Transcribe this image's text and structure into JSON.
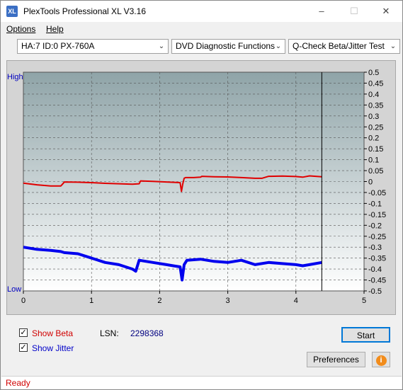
{
  "window": {
    "title": "PlexTools Professional XL V3.16",
    "icon_text": "XL"
  },
  "menu": {
    "items": [
      {
        "label": "Options"
      },
      {
        "label": "Help"
      }
    ]
  },
  "toolbar": {
    "drive": "HA:7 ID:0  PX-760A",
    "function": "DVD Diagnostic Functions",
    "test": "Q-Check Beta/Jitter Test"
  },
  "chart_data": {
    "type": "line",
    "ylabel_top": "High",
    "ylabel_bottom": "Low",
    "x_ticks": [
      "0",
      "1",
      "2",
      "3",
      "4",
      "5"
    ],
    "xlim": [
      0,
      5
    ],
    "y_ticks": [
      "0.5",
      "0.45",
      "0.4",
      "0.35",
      "0.3",
      "0.25",
      "0.2",
      "0.15",
      "0.1",
      "0.05",
      "0",
      "-0.05",
      "-0.1",
      "-0.15",
      "-0.2",
      "-0.25",
      "-0.3",
      "-0.35",
      "-0.4",
      "-0.45",
      "-0.5"
    ],
    "ylim": [
      -0.5,
      0.5
    ],
    "marker_x": 4.38,
    "grid": true,
    "series": [
      {
        "key": "beta",
        "color": "#e00000",
        "x": [
          0,
          0.2,
          0.4,
          0.55,
          0.58,
          0.6,
          0.8,
          1.0,
          1.2,
          1.4,
          1.6,
          1.7,
          1.72,
          1.9,
          2.1,
          2.3,
          2.32,
          2.34,
          2.36,
          2.38,
          2.5,
          2.6,
          2.62,
          2.8,
          3.0,
          3.2,
          3.4,
          3.5,
          3.6,
          3.8,
          4.0,
          4.1,
          4.2,
          4.38
        ],
        "y": [
          -0.007,
          -0.015,
          -0.02,
          -0.02,
          -0.01,
          -0.002,
          -0.003,
          -0.005,
          -0.008,
          -0.01,
          -0.012,
          -0.01,
          0.003,
          0.001,
          -0.002,
          -0.005,
          -0.045,
          -0.01,
          0.015,
          0.018,
          0.018,
          0.02,
          0.024,
          0.022,
          0.021,
          0.018,
          0.015,
          0.015,
          0.024,
          0.025,
          0.023,
          0.02,
          0.026,
          0.022
        ]
      },
      {
        "key": "jitter",
        "color": "#0000ee",
        "x": [
          0,
          0.2,
          0.4,
          0.55,
          0.6,
          0.8,
          1.0,
          1.2,
          1.4,
          1.5,
          1.6,
          1.65,
          1.7,
          1.9,
          2.1,
          2.2,
          2.3,
          2.33,
          2.36,
          2.4,
          2.6,
          2.8,
          3.0,
          3.2,
          3.4,
          3.6,
          3.8,
          4.0,
          4.1,
          4.2,
          4.38
        ],
        "y": [
          -0.3,
          -0.31,
          -0.315,
          -0.32,
          -0.325,
          -0.33,
          -0.35,
          -0.37,
          -0.38,
          -0.39,
          -0.4,
          -0.41,
          -0.36,
          -0.37,
          -0.38,
          -0.385,
          -0.39,
          -0.45,
          -0.38,
          -0.36,
          -0.355,
          -0.365,
          -0.37,
          -0.36,
          -0.38,
          -0.37,
          -0.375,
          -0.38,
          -0.385,
          -0.38,
          -0.37
        ]
      }
    ]
  },
  "controls": {
    "show_beta": {
      "label": "Show Beta",
      "checked": true,
      "color": "#d00000"
    },
    "show_jitter": {
      "label": "Show Jitter",
      "checked": true,
      "color": "#0000c8"
    },
    "lsn_label": "LSN:",
    "lsn_value": "2298368",
    "start_label": "Start",
    "preferences_label": "Preferences",
    "info_icon": "info-icon"
  },
  "status": {
    "text": "Ready"
  }
}
